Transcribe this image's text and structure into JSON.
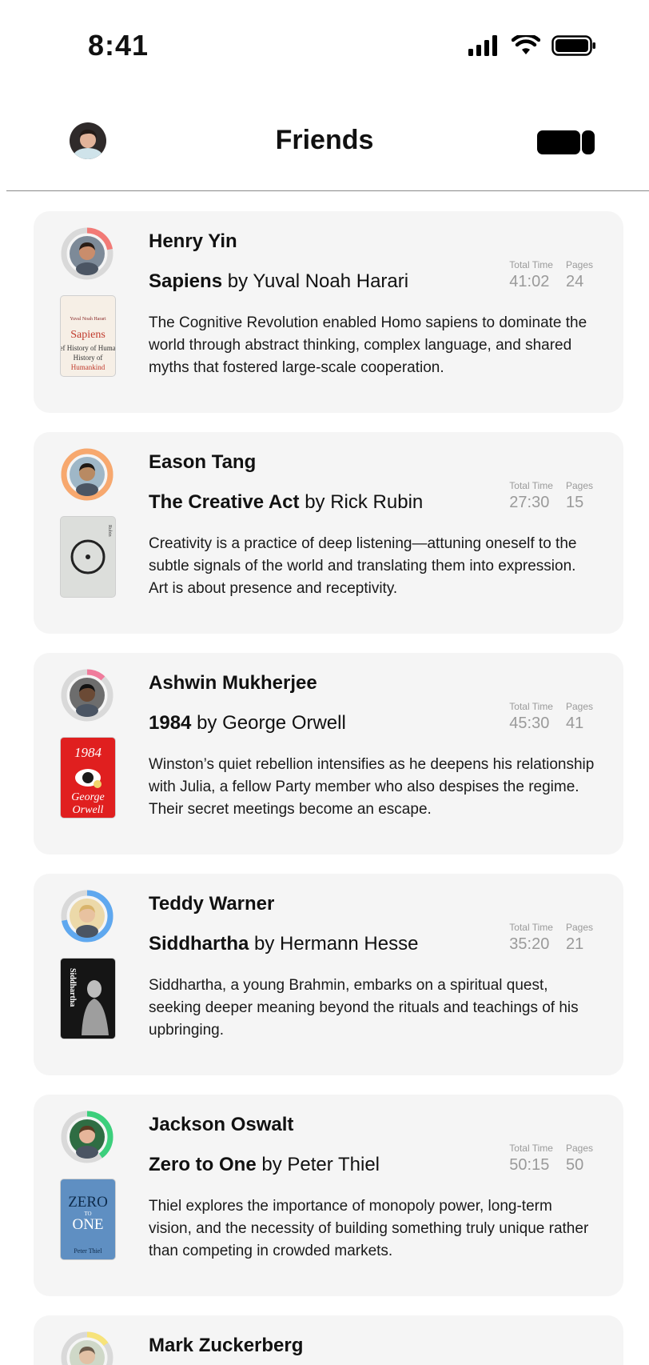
{
  "status_bar": {
    "time": "8:41"
  },
  "header": {
    "title": "Friends"
  },
  "labels": {
    "total_time": "Total Time",
    "pages": "Pages",
    "by": "by"
  },
  "feed": [
    {
      "name": "Henry Yin",
      "book_title": "Sapiens",
      "author": "Yuval Noah Harari",
      "total_time": "41:02",
      "pages": "24",
      "summary": "The Cognitive Revolution enabled Homo sapiens to dominate the world through abstract thinking, complex language, and shared myths that fostered large-scale cooperation.",
      "ring_color": "#f27a76",
      "ring_progress": 0.22,
      "cover_color": "#f6efe6",
      "cover_text": [
        "Yuval Noah Harari",
        "Sapiens",
        "A Brief History of Humankind"
      ]
    },
    {
      "name": "Eason Tang",
      "book_title": "The Creative Act",
      "author": "Rick Rubin",
      "total_time": "27:30",
      "pages": "15",
      "summary": "Creativity is a practice of deep listening—attuning oneself to the subtle signals of the world and translating them into expression. Art is about presence and receptivity.",
      "ring_color": "#f7a86e",
      "ring_progress": 1.0,
      "cover_color": "#dcdedb",
      "cover_text": [
        "Rubin"
      ]
    },
    {
      "name": "Ashwin Mukherjee",
      "book_title": "1984",
      "author": "George Orwell",
      "total_time": "45:30",
      "pages": "41",
      "summary": "Winston’s quiet rebellion intensifies as he deepens his relationship with Julia, a fellow Party member who also despises the regime. Their secret meetings become an escape.",
      "ring_color": "#f07c9c",
      "ring_progress": 0.12,
      "cover_color": "#e01f1f",
      "cover_text": [
        "1984",
        "George",
        "Orwell"
      ]
    },
    {
      "name": "Teddy Warner",
      "book_title": "Siddhartha",
      "author": "Hermann Hesse",
      "total_time": "35:20",
      "pages": "21",
      "summary": "Siddhartha, a young Brahmin, embarks on a spiritual quest, seeking deeper meaning beyond the rituals and teachings of his upbringing.",
      "ring_color": "#5fa8ef",
      "ring_progress": 0.72,
      "cover_color": "#151515",
      "cover_text": [
        "Siddhartha"
      ]
    },
    {
      "name": "Jackson Oswalt",
      "book_title": "Zero to One",
      "author": "Peter Thiel",
      "total_time": "50:15",
      "pages": "50",
      "summary": "Thiel explores the importance of monopoly power, long-term vision, and the necessity of building something truly unique rather than competing in crowded markets.",
      "ring_color": "#3ccf7c",
      "ring_progress": 0.4,
      "cover_color": "#5f8fc2",
      "cover_text": [
        "ZERO",
        "TO",
        "ONE",
        "Peter Thiel"
      ]
    }
  ],
  "partial_item": {
    "name": "Mark Zuckerberg",
    "ring_color": "#f7e37a"
  }
}
